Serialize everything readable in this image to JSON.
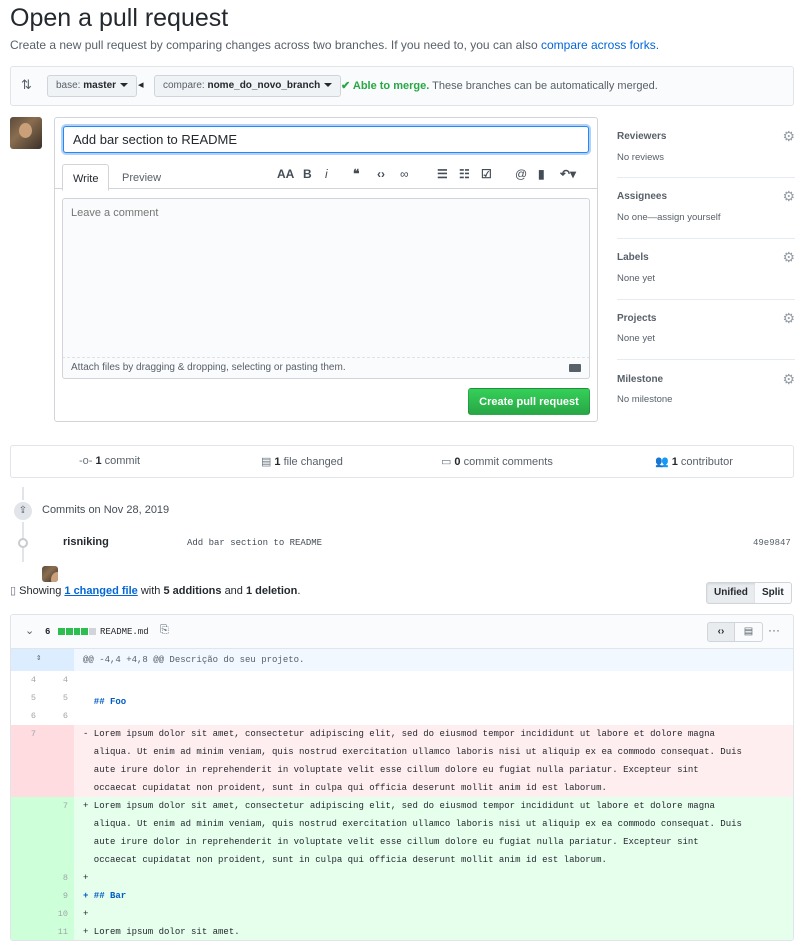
{
  "page": {
    "title": "Open a pull request",
    "subtitle": "Create a new pull request by comparing changes across two branches. If you need to, you can also",
    "subtitle_link": "compare across forks."
  },
  "compare": {
    "base_label": "base:",
    "base_value": "master",
    "compare_label": "compare:",
    "compare_value": "nome_do_novo_branch",
    "merge_status": "Able to merge.",
    "merge_note": "These branches can be automatically merged."
  },
  "form": {
    "title_value": "Add bar section to README",
    "tab_write": "Write",
    "tab_preview": "Preview",
    "comment_placeholder": "Leave a comment",
    "attach_text": "Attach files by dragging & dropping, selecting or pasting them.",
    "submit_label": "Create pull request"
  },
  "sidebar": {
    "reviewers_h": "Reviewers",
    "reviewers_v": "No reviews",
    "assignees_h": "Assignees",
    "assignees_v": "No one—assign yourself",
    "labels_h": "Labels",
    "labels_v": "None yet",
    "projects_h": "Projects",
    "projects_v": "None yet",
    "milestone_h": "Milestone",
    "milestone_v": "No milestone"
  },
  "stats": {
    "commits_n": "1",
    "commits_l": "commit",
    "files_n": "1",
    "files_l": "file changed",
    "comments_n": "0",
    "comments_l": "commit comments",
    "contrib_n": "1",
    "contrib_l": "contributor"
  },
  "commits": {
    "date_heading": "Commits on Nov 28, 2019",
    "author": "risniking",
    "message": "Add bar section to README",
    "sha": "49e9847"
  },
  "diff_summary": {
    "showing": "Showing",
    "changed": "1 changed file",
    "with": "with",
    "additions": "5 additions",
    "and": "and",
    "deletions": "1 deletion",
    "unified": "Unified",
    "split": "Split"
  },
  "file": {
    "count": "6",
    "name": "README.md",
    "hunk": "@@ -4,4 +4,8 @@ Descrição do seu projeto.",
    "lines": [
      {
        "old": "4",
        "new": "4",
        "type": "ctx",
        "text": ""
      },
      {
        "old": "5",
        "new": "5",
        "type": "ctx",
        "text": "  ## Foo"
      },
      {
        "old": "6",
        "new": "6",
        "type": "ctx",
        "text": ""
      },
      {
        "old": "7",
        "new": "",
        "type": "del",
        "text": "- Lorem ipsum dolor sit amet, consectetur adipiscing elit, sed do eiusmod tempor incididunt ut labore et dolore magna\n  aliqua. Ut enim ad minim veniam, quis nostrud exercitation ullamco laboris nisi ut aliquip ex ea commodo consequat. Duis\n  aute irure dolor in reprehenderit in voluptate velit esse cillum dolore eu fugiat nulla pariatur. Excepteur sint\n  occaecat cupidatat non proident, sunt in culpa qui officia deserunt mollit anim id est laborum."
      },
      {
        "old": "",
        "new": "7",
        "type": "add",
        "text": "+ Lorem ipsum dolor sit amet, consectetur adipiscing elit, sed do eiusmod tempor incididunt ut labore et dolore magna\n  aliqua. Ut enim ad minim veniam, quis nostrud exercitation ullamco laboris nisi ut aliquip ex ea commodo consequat. Duis\n  aute irure dolor in reprehenderit in voluptate velit esse cillum dolore eu fugiat nulla pariatur. Excepteur sint\n  occaecat cupidatat non proident, sunt in culpa qui officia deserunt mollit anim id est laborum."
      },
      {
        "old": "",
        "new": "8",
        "type": "add",
        "text": "+"
      },
      {
        "old": "",
        "new": "9",
        "type": "add",
        "text": "+ ## Bar"
      },
      {
        "old": "",
        "new": "10",
        "type": "add",
        "text": "+"
      },
      {
        "old": "",
        "new": "11",
        "type": "add",
        "text": "+ Lorem ipsum dolor sit amet."
      }
    ]
  },
  "colors": {
    "accent": "#0366d6",
    "success": "#28a745",
    "del_bg": "#ffeef0",
    "del_num_bg": "#ffdce0",
    "add_bg": "#e6ffed",
    "add_num_bg": "#cdffd8",
    "hunk_bg": "#f1f8ff",
    "hunk_num_bg": "#dbedff"
  }
}
